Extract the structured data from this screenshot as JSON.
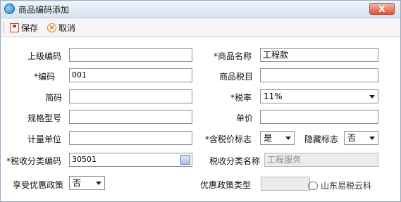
{
  "window": {
    "title": "商品编码添加",
    "close_label": "X"
  },
  "toolbar": {
    "save_label": "保存",
    "cancel_label": "取消"
  },
  "form": {
    "parent_code_label": "上级编码",
    "parent_code_value": "",
    "product_name_label": "*商品名称",
    "product_name_value": "工程款",
    "code_label": "*编码",
    "code_value": "001",
    "tax_item_label": "商品税目",
    "tax_item_value": "",
    "short_code_label": "简码",
    "short_code_value": "",
    "tax_rate_label": "*税率",
    "tax_rate_value": "11%",
    "spec_label": "规格型号",
    "spec_value": "",
    "unit_price_label": "单价",
    "unit_price_value": "",
    "unit_label": "计量单位",
    "unit_value": "",
    "tax_included_label": "*含税价标志",
    "tax_included_value": "是",
    "hidden_flag_label": "隐藏标志",
    "hidden_flag_value": "否",
    "tax_class_code_label": "*税收分类编码",
    "tax_class_code_value": "30501",
    "tax_class_name_label": "税收分类名称",
    "tax_class_name_value": "工程服务",
    "preferential_label": "享受优惠政策",
    "preferential_value": "否",
    "preferential_type_label": "优惠政策类型",
    "preferential_type_value": ""
  },
  "watermark": {
    "text": "山东易税云科"
  }
}
